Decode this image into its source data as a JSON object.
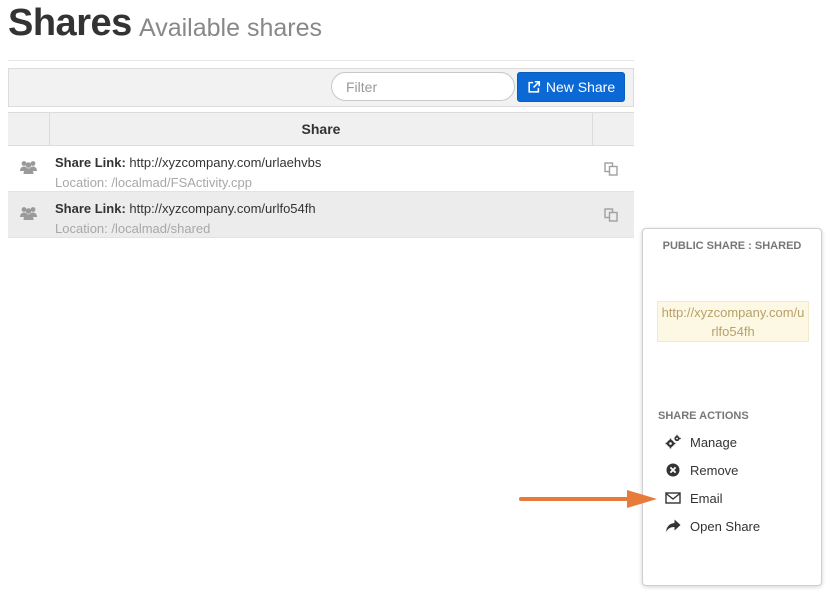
{
  "header": {
    "title": "Shares",
    "subtitle": "Available shares"
  },
  "toolbar": {
    "filter_placeholder": "Filter",
    "new_share_label": "New Share",
    "new_share_icon": "external-link-icon",
    "new_share_color": "#0b69d6"
  },
  "table": {
    "column_header": "Share",
    "rows": [
      {
        "icon": "users-icon",
        "link_label": "Share Link:",
        "link": "http://xyzcompany.com/urlaehvbs",
        "location": "Location: /localmad/FSActivity.cpp",
        "action_icon": "copy-icon",
        "selected": false
      },
      {
        "icon": "users-icon",
        "link_label": "Share Link:",
        "link": "http://xyzcompany.com/urlfo54fh",
        "location": "Location: /localmad/shared",
        "action_icon": "copy-icon",
        "selected": true
      }
    ]
  },
  "panel": {
    "title": "PUBLIC SHARE : SHARED",
    "url": "http://xyzcompany.com/urlfo54fh",
    "actions_title": "SHARE ACTIONS",
    "actions": [
      {
        "label": "Manage",
        "icon": "gears-icon"
      },
      {
        "label": "Remove",
        "icon": "remove-circle-icon"
      },
      {
        "label": "Email",
        "icon": "envelope-icon"
      },
      {
        "label": "Open Share",
        "icon": "share-arrow-icon"
      }
    ]
  },
  "annotation": {
    "color": "#e87a3a",
    "points_to": "Email"
  }
}
